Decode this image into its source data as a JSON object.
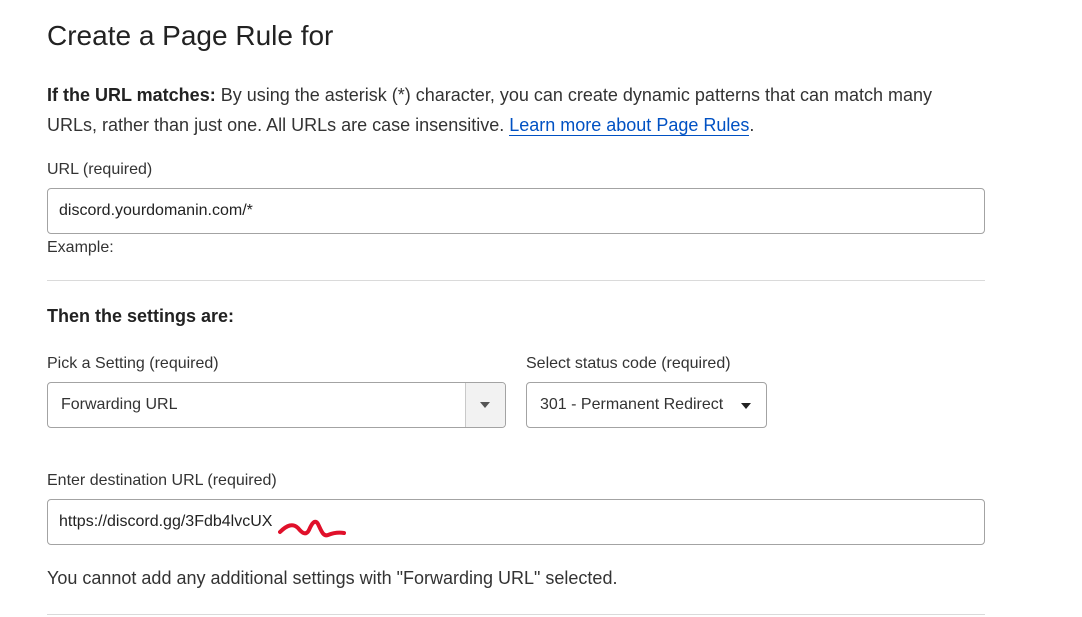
{
  "page": {
    "title": "Create a Page Rule for"
  },
  "intro": {
    "label": "If the URL matches:",
    "text": " By using the asterisk (*) character, you can create dynamic patterns that can match many URLs, rather than just one. All URLs are case insensitive. ",
    "link_text": "Learn more about Page Rules",
    "trailing": "."
  },
  "url_field": {
    "label": "URL (required)",
    "value": "discord.yourdomanin.com/*",
    "example_label": "Example:"
  },
  "settings": {
    "heading": "Then the settings are:",
    "setting_label": "Pick a Setting (required)",
    "setting_value": "Forwarding URL",
    "status_label": "Select status code (required)",
    "status_value": "301 - Permanent Redirect"
  },
  "destination": {
    "label": "Enter destination URL (required)",
    "value": "https://discord.gg/3Fdb4lvcUX"
  },
  "note": "You cannot add any additional settings with \"Forwarding URL\" selected.",
  "colors": {
    "link": "#0051c3",
    "redaction": "#e0102a",
    "border": "#a3a3a3",
    "divider": "#dadada"
  }
}
